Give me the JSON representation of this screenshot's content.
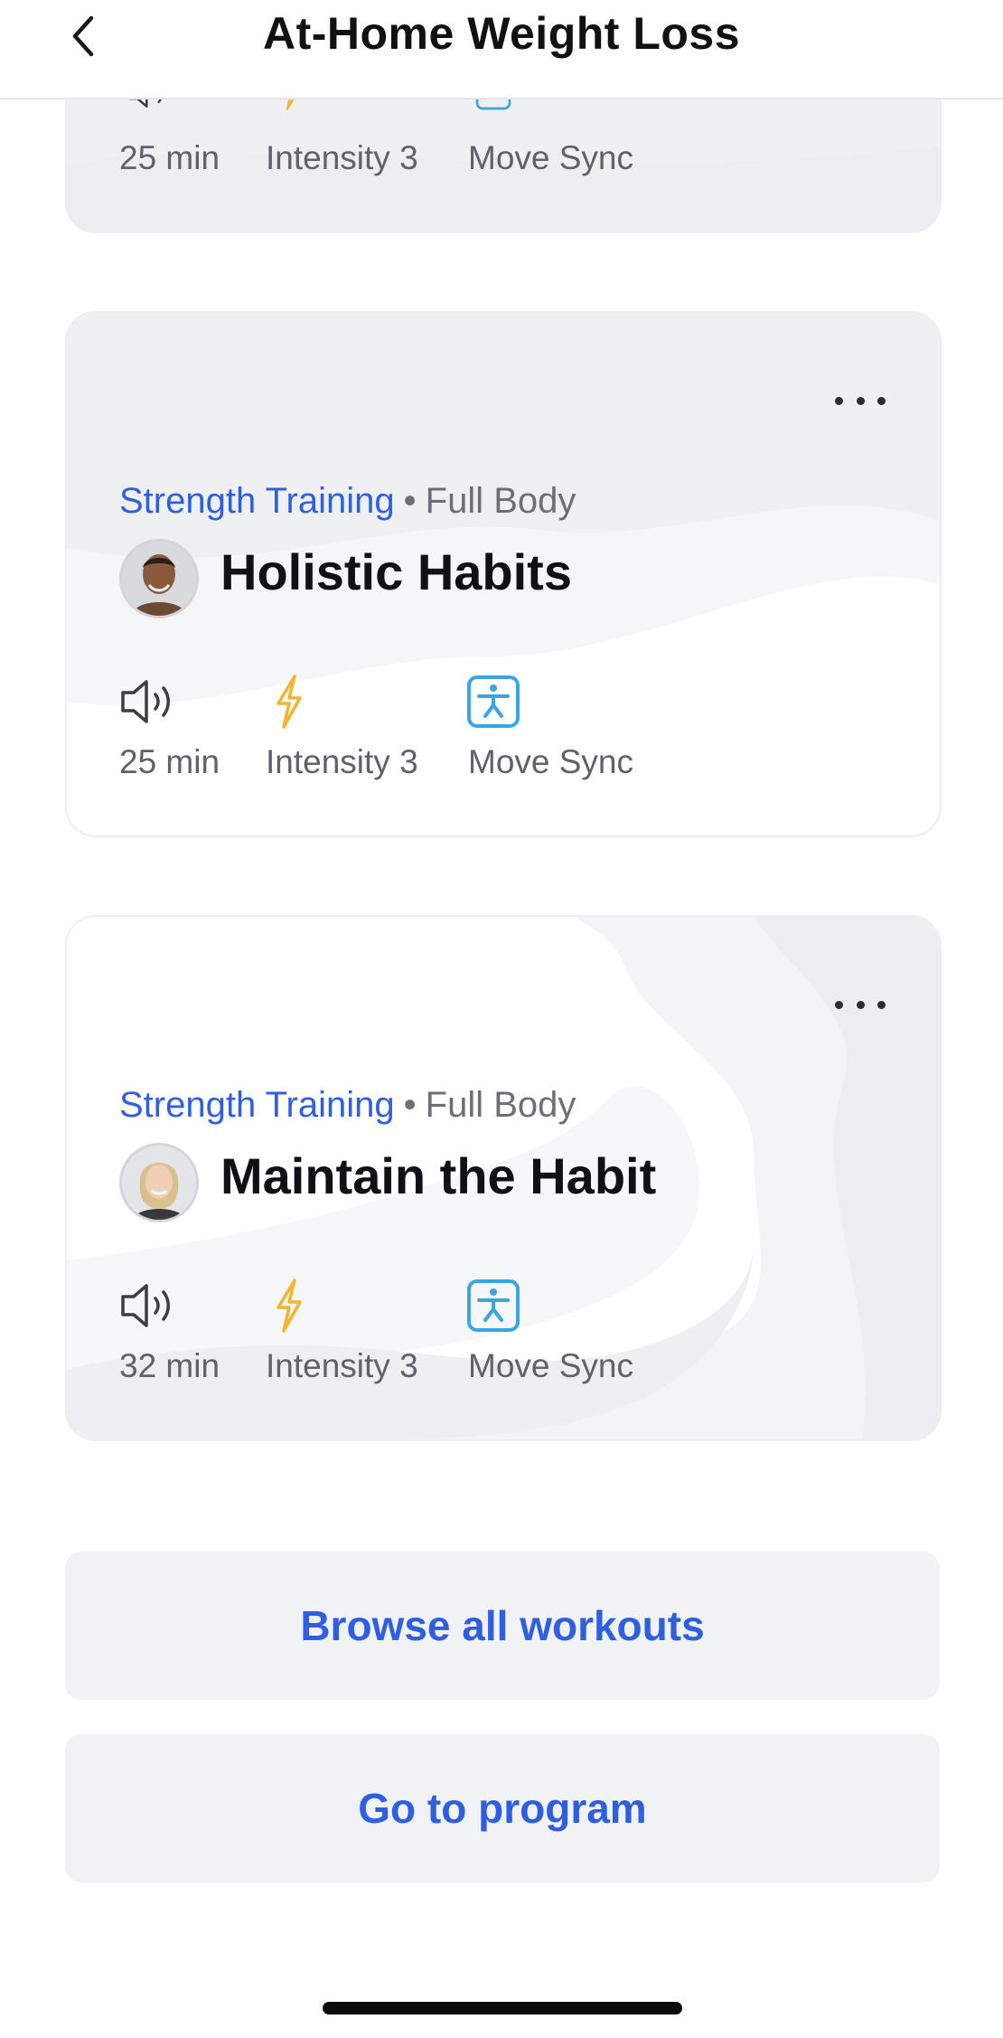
{
  "header": {
    "title": "At-Home Weight Loss",
    "back_icon": "chevron-left-icon"
  },
  "cards": [
    {
      "stats": {
        "duration": "25 min",
        "intensity": "Intensity 3",
        "move_sync": "Move Sync"
      }
    },
    {
      "category": "Strength Training",
      "separator": "•",
      "subcategory": "Full Body",
      "title": "Holistic Habits",
      "stats": {
        "duration": "25 min",
        "intensity": "Intensity 3",
        "move_sync": "Move Sync"
      }
    },
    {
      "category": "Strength Training",
      "separator": "•",
      "subcategory": "Full Body",
      "title": "Maintain the Habit",
      "stats": {
        "duration": "32 min",
        "intensity": "Intensity 3",
        "move_sync": "Move Sync"
      }
    }
  ],
  "buttons": {
    "browse": "Browse all workouts",
    "program": "Go to program"
  },
  "colors": {
    "accent": "#2f5fe0",
    "intensity": "#f2b431",
    "move_sync": "#3ba4e3"
  }
}
